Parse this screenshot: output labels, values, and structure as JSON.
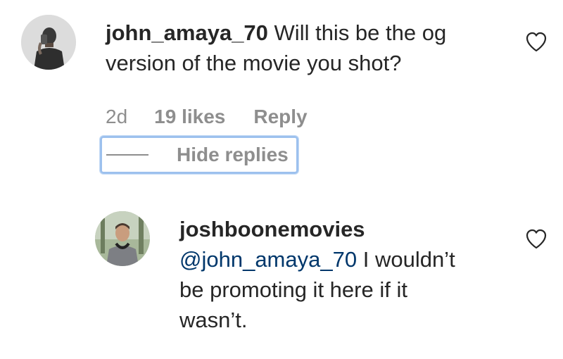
{
  "comment": {
    "username": "john_amaya_70",
    "text_line1": "Will this be the og",
    "text_line2": "version of the movie you shot?",
    "time": "2d",
    "likes": "19 likes",
    "reply_label": "Reply",
    "like_icon": "heart-outline-icon",
    "avatar": "user-avatar-john"
  },
  "replies_toggle": {
    "label": "Hide replies"
  },
  "reply": {
    "username": "joshboonemovies",
    "mention": "@john_amaya_70",
    "text_after_mention": "I wouldn’t",
    "text_line2": "be promoting it here if it",
    "text_line3": "wasn’t.",
    "like_icon": "heart-outline-icon",
    "avatar": "user-avatar-joshboone"
  },
  "colors": {
    "text": "#262626",
    "secondary": "#8e8e8e",
    "mention": "#00376b",
    "focus_ring": "#9dc1ee"
  }
}
